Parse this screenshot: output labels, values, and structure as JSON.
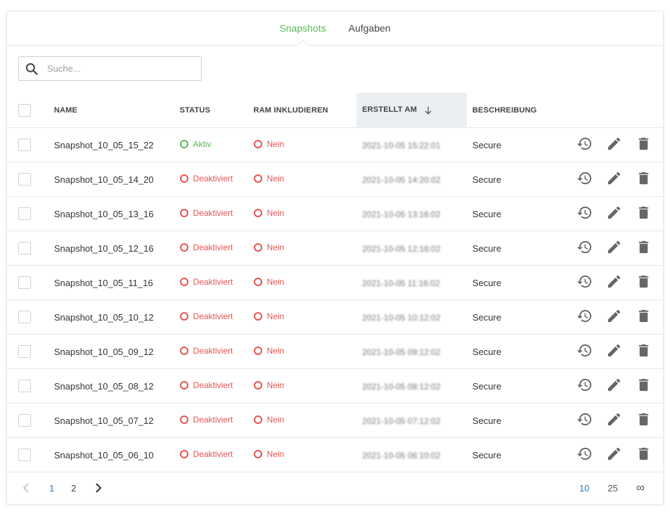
{
  "tabs": [
    {
      "label": "Snapshots",
      "active": true
    },
    {
      "label": "Aufgaben",
      "active": false
    }
  ],
  "search": {
    "placeholder": "Suche...",
    "value": ""
  },
  "table": {
    "columns": {
      "name": "NAME",
      "status": "STATUS",
      "ram": "RAM INKLUDIEREN",
      "created": "ERSTELLT AM",
      "description": "BESCHREIBUNG"
    },
    "sorted_column": "created",
    "sort_direction": "descending",
    "rows": [
      {
        "name": "Snapshot_10_05_15_22",
        "status": "Aktiv",
        "status_state": "active",
        "ram": "Nein",
        "created": "2021-10-05 15:22:01",
        "description": "Secure"
      },
      {
        "name": "Snapshot_10_05_14_20",
        "status": "Deaktiviert",
        "status_state": "inactive",
        "ram": "Nein",
        "created": "2021-10-05 14:20:02",
        "description": "Secure"
      },
      {
        "name": "Snapshot_10_05_13_16",
        "status": "Deaktiviert",
        "status_state": "inactive",
        "ram": "Nein",
        "created": "2021-10-05 13:16:02",
        "description": "Secure"
      },
      {
        "name": "Snapshot_10_05_12_16",
        "status": "Deaktiviert",
        "status_state": "inactive",
        "ram": "Nein",
        "created": "2021-10-05 12:16:02",
        "description": "Secure"
      },
      {
        "name": "Snapshot_10_05_11_16",
        "status": "Deaktiviert",
        "status_state": "inactive",
        "ram": "Nein",
        "created": "2021-10-05 11:16:02",
        "description": "Secure"
      },
      {
        "name": "Snapshot_10_05_10_12",
        "status": "Deaktiviert",
        "status_state": "inactive",
        "ram": "Nein",
        "created": "2021-10-05 10:12:02",
        "description": "Secure"
      },
      {
        "name": "Snapshot_10_05_09_12",
        "status": "Deaktiviert",
        "status_state": "inactive",
        "ram": "Nein",
        "created": "2021-10-05 09:12:02",
        "description": "Secure"
      },
      {
        "name": "Snapshot_10_05_08_12",
        "status": "Deaktiviert",
        "status_state": "inactive",
        "ram": "Nein",
        "created": "2021-10-05 08:12:02",
        "description": "Secure"
      },
      {
        "name": "Snapshot_10_05_07_12",
        "status": "Deaktiviert",
        "status_state": "inactive",
        "ram": "Nein",
        "created": "2021-10-05 07:12:02",
        "description": "Secure"
      },
      {
        "name": "Snapshot_10_05_06_10",
        "status": "Deaktiviert",
        "status_state": "inactive",
        "ram": "Nein",
        "created": "2021-10-05 06:10:02",
        "description": "Secure"
      }
    ],
    "row_action_icons": [
      "restore-icon",
      "edit-icon",
      "delete-icon"
    ]
  },
  "pagination": {
    "pages": [
      {
        "label": "1",
        "active": true
      },
      {
        "label": "2",
        "active": false
      }
    ],
    "page_sizes": [
      {
        "label": "10",
        "active": true
      },
      {
        "label": "25",
        "active": false
      },
      {
        "label": "∞",
        "active": false
      }
    ]
  },
  "colors": {
    "accent_green": "#5cb85c",
    "inactive_red": "#e55353",
    "link_blue": "#337ab7",
    "icon_gray": "#666666"
  }
}
